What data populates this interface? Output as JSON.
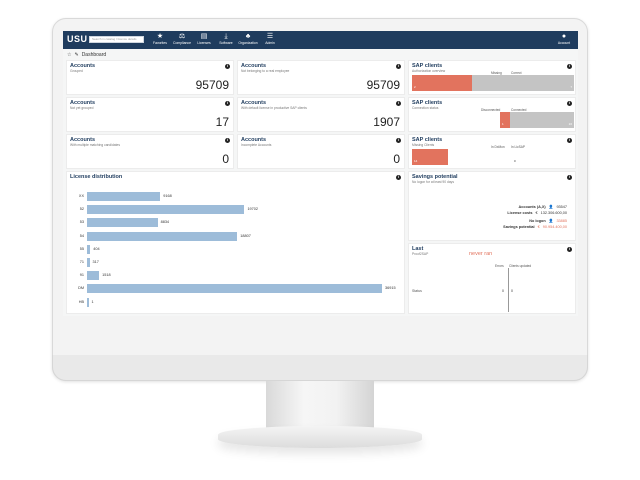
{
  "topbar": {
    "logo": "USU",
    "search_placeholder": "Search in catalog / licence details",
    "nav": [
      {
        "label": "Favorites",
        "icon": "star-icon"
      },
      {
        "label": "Compliance",
        "icon": "scale-icon"
      },
      {
        "label": "Licenses",
        "icon": "document-icon"
      },
      {
        "label": "Software",
        "icon": "download-icon"
      },
      {
        "label": "Organization",
        "icon": "org-chart-icon"
      },
      {
        "label": "Admin",
        "icon": "menu-icon"
      }
    ],
    "account_label": "Account"
  },
  "breadcrumb": {
    "title": "Dashboard"
  },
  "accounts_panels": [
    {
      "title": "Accounts",
      "subtitle": "Grouped",
      "value": "95709"
    },
    {
      "title": "Accounts",
      "subtitle": "Not belonging to a real employee",
      "value": "95709"
    },
    {
      "title": "Accounts",
      "subtitle": "Not yet grouped",
      "value": "17"
    },
    {
      "title": "Accounts",
      "subtitle": "With default license in productive SAP clients",
      "value": "1907"
    },
    {
      "title": "Accounts",
      "subtitle": "With multiple matching candidates",
      "value": "0"
    },
    {
      "title": "Accounts",
      "subtitle": "Incomplete Accounts",
      "value": "0"
    }
  ],
  "sap_panels": [
    {
      "title": "SAP clients",
      "subtitle": "Authorization overview",
      "col_a": "Missing",
      "col_b": "Correct",
      "val_a": "2",
      "val_b": "7",
      "fraction_a": 0.5
    },
    {
      "title": "SAP clients",
      "subtitle": "Connection status",
      "col_a": "Disconnected",
      "col_b": "Connected",
      "val_a": "1",
      "val_b": "16",
      "fraction_a": 0.06
    },
    {
      "title": "SAP clients",
      "subtitle": "Missing Clients",
      "col_a": "In DxMon",
      "col_b": "In LicSAP",
      "val_a": "14",
      "val_b": "0",
      "fraction_a": 0.5
    }
  ],
  "license_distribution": {
    "title": "License distribution",
    "rows": [
      {
        "label": "XX",
        "value": 9168
      },
      {
        "label": "52",
        "value": 19702
      },
      {
        "label": "53",
        "value": 8834
      },
      {
        "label": "54",
        "value": 18807
      },
      {
        "label": "55",
        "value": 404
      },
      {
        "label": "71",
        "value": 317
      },
      {
        "label": "91",
        "value": 1518
      },
      {
        "label": "DM",
        "value": 36915
      },
      {
        "label": "HB",
        "value": 1
      }
    ],
    "max": 36915
  },
  "savings": {
    "title": "Savings potential",
    "subtitle": "No logon for at least 90 days",
    "rows": [
      {
        "label": "Accounts (A,X)",
        "icon": "person-icon",
        "value": "93547"
      },
      {
        "label": "License costs",
        "icon": "euro-icon",
        "value": "132.306.600,00"
      },
      {
        "label": "No logon",
        "icon": "person-icon",
        "value": "33885",
        "highlight": true
      },
      {
        "label": "Savings potential",
        "icon": "euro-icon",
        "value": "90.954.400,00",
        "highlight": true
      }
    ]
  },
  "last": {
    "title": "Last",
    "subtitle": "Proof2SAP",
    "status_text": "never ran",
    "col_a": "Errors",
    "col_b": "Clients updated",
    "row_label": "Status",
    "val_a": "0",
    "val_b": "0"
  },
  "colors": {
    "navy": "#1f3c5e",
    "bar": "#9dbcd9",
    "salmon": "#e2735e",
    "grey": "#c4c4c4"
  }
}
